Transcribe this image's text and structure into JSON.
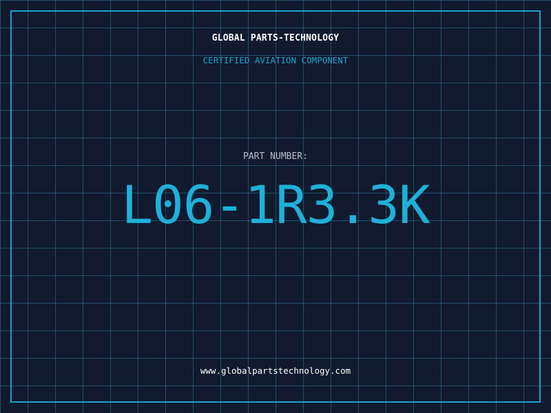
{
  "header": {
    "company_name": "GLOBAL PARTS-TECHNOLOGY",
    "tagline": "CERTIFIED AVIATION COMPONENT"
  },
  "part": {
    "label": "PART NUMBER:",
    "number": "L06-1R3.3K"
  },
  "footer": {
    "website": "www.globalpartstechnology.com"
  },
  "colors": {
    "background": "#111a2f",
    "grid": "#287896",
    "accent": "#1aa3cc",
    "text_primary": "#ffffff",
    "text_muted": "#b8bfcc"
  }
}
